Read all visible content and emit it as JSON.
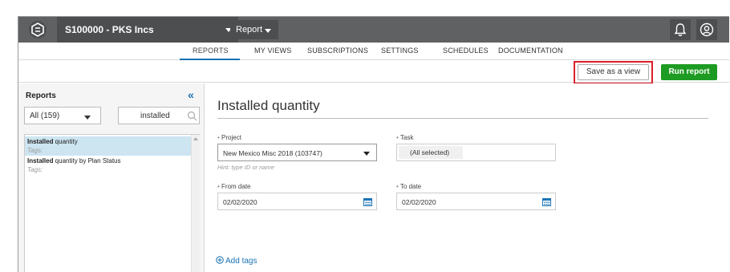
{
  "topbar": {
    "account_name": "S100000 - PKS Incs",
    "report_menu_label": "Report"
  },
  "nav": {
    "tabs": [
      {
        "label": "REPORTS",
        "active": true
      },
      {
        "label": "MY VIEWS"
      },
      {
        "label": "SUBSCRIPTIONS"
      },
      {
        "label": "SETTINGS"
      },
      {
        "label": "SCHEDULES"
      },
      {
        "label": "DOCUMENTATION"
      }
    ]
  },
  "actions": {
    "save_view_label": "Save as a view",
    "run_report_label": "Run report"
  },
  "sidebar": {
    "title": "Reports",
    "filter_value": "All (159)",
    "search_value": "installed",
    "items": [
      {
        "bold": "Installed",
        "rest": " quantity",
        "tags": "Tags:",
        "selected": true
      },
      {
        "bold": "Installed",
        "rest": " quantity by Plan Status",
        "tags": "Tags:"
      }
    ]
  },
  "main": {
    "title": "Installed quantity",
    "project": {
      "label": "Project",
      "value": "New Mexico Misc 2018 (103747)",
      "hint": "Hint: type ID or name"
    },
    "task": {
      "label": "Task",
      "value": "(All selected)"
    },
    "from_date": {
      "label": "From date",
      "value": "02/02/2020"
    },
    "to_date": {
      "label": "To date",
      "value": "02/02/2020"
    },
    "add_tags_label": "Add tags",
    "required_marker": "•"
  },
  "colors": {
    "topbar": "#5f6163",
    "accent_blue": "#1a73b5",
    "run_green": "#1e9b22",
    "highlight_red": "#d9202b",
    "selected_row": "#cde4f1"
  }
}
